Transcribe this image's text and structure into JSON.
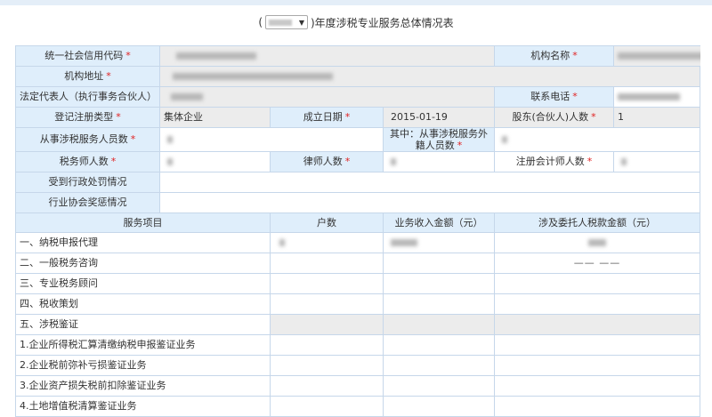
{
  "page": {
    "title_prefix": "(",
    "title_suffix": ")年度涉税专业服务总体情况表"
  },
  "form": {
    "credit_code": {
      "label": "统一社会信用代码",
      "req": "*"
    },
    "org_name": {
      "label": "机构名称",
      "req": "*"
    },
    "address": {
      "label": "机构地址",
      "req": "*"
    },
    "legal_rep": {
      "label": "法定代表人（执行事务合伙人）",
      "req": "*"
    },
    "phone": {
      "label": "联系电话",
      "req": "*"
    },
    "reg_type": {
      "label": "登记注册类型",
      "req": "*",
      "value": "集体企业"
    },
    "est_date": {
      "label": "成立日期",
      "req": "*",
      "value": "2015-01-19"
    },
    "partners": {
      "label": "股东(合伙人)人数",
      "req": "*",
      "value": "1"
    },
    "staff": {
      "label": "从事涉税服务人员数",
      "req": "*"
    },
    "foreign_staff": {
      "label": "其中：从事涉税服务外籍人员数",
      "req": "*"
    },
    "tax_agents": {
      "label": "税务师人数",
      "req": "*"
    },
    "lawyers": {
      "label": "律师人数",
      "req": "*"
    },
    "accountants": {
      "label": "注册会计师人数",
      "req": "*"
    },
    "penalty": {
      "label": "受到行政处罚情况"
    },
    "awards": {
      "label": "行业协会奖惩情况"
    }
  },
  "services": {
    "headers": [
      "服务项目",
      "户数",
      "业务收入金额（元）",
      "涉及委托人税款金额（元）"
    ],
    "rows": [
      {
        "label": "一、纳税申报代理",
        "amount": ""
      },
      {
        "label": "二、一般税务咨询",
        "amount": "—— ——"
      },
      {
        "label": "三、专业税务顾问",
        "amount": ""
      },
      {
        "label": "四、税收策划",
        "amount": ""
      },
      {
        "label": "五、涉税鉴证",
        "amount": ""
      },
      {
        "label": "1.企业所得税汇算清缴纳税申报鉴证业务",
        "amount": ""
      },
      {
        "label": "2.企业税前弥补亏损鉴证业务",
        "amount": ""
      },
      {
        "label": "3.企业资产损失税前扣除鉴证业务",
        "amount": ""
      },
      {
        "label": "4.土地增值税清算鉴证业务",
        "amount": ""
      }
    ]
  },
  "icons": {
    "select_arrow": "dropdown-arrow-icon"
  }
}
